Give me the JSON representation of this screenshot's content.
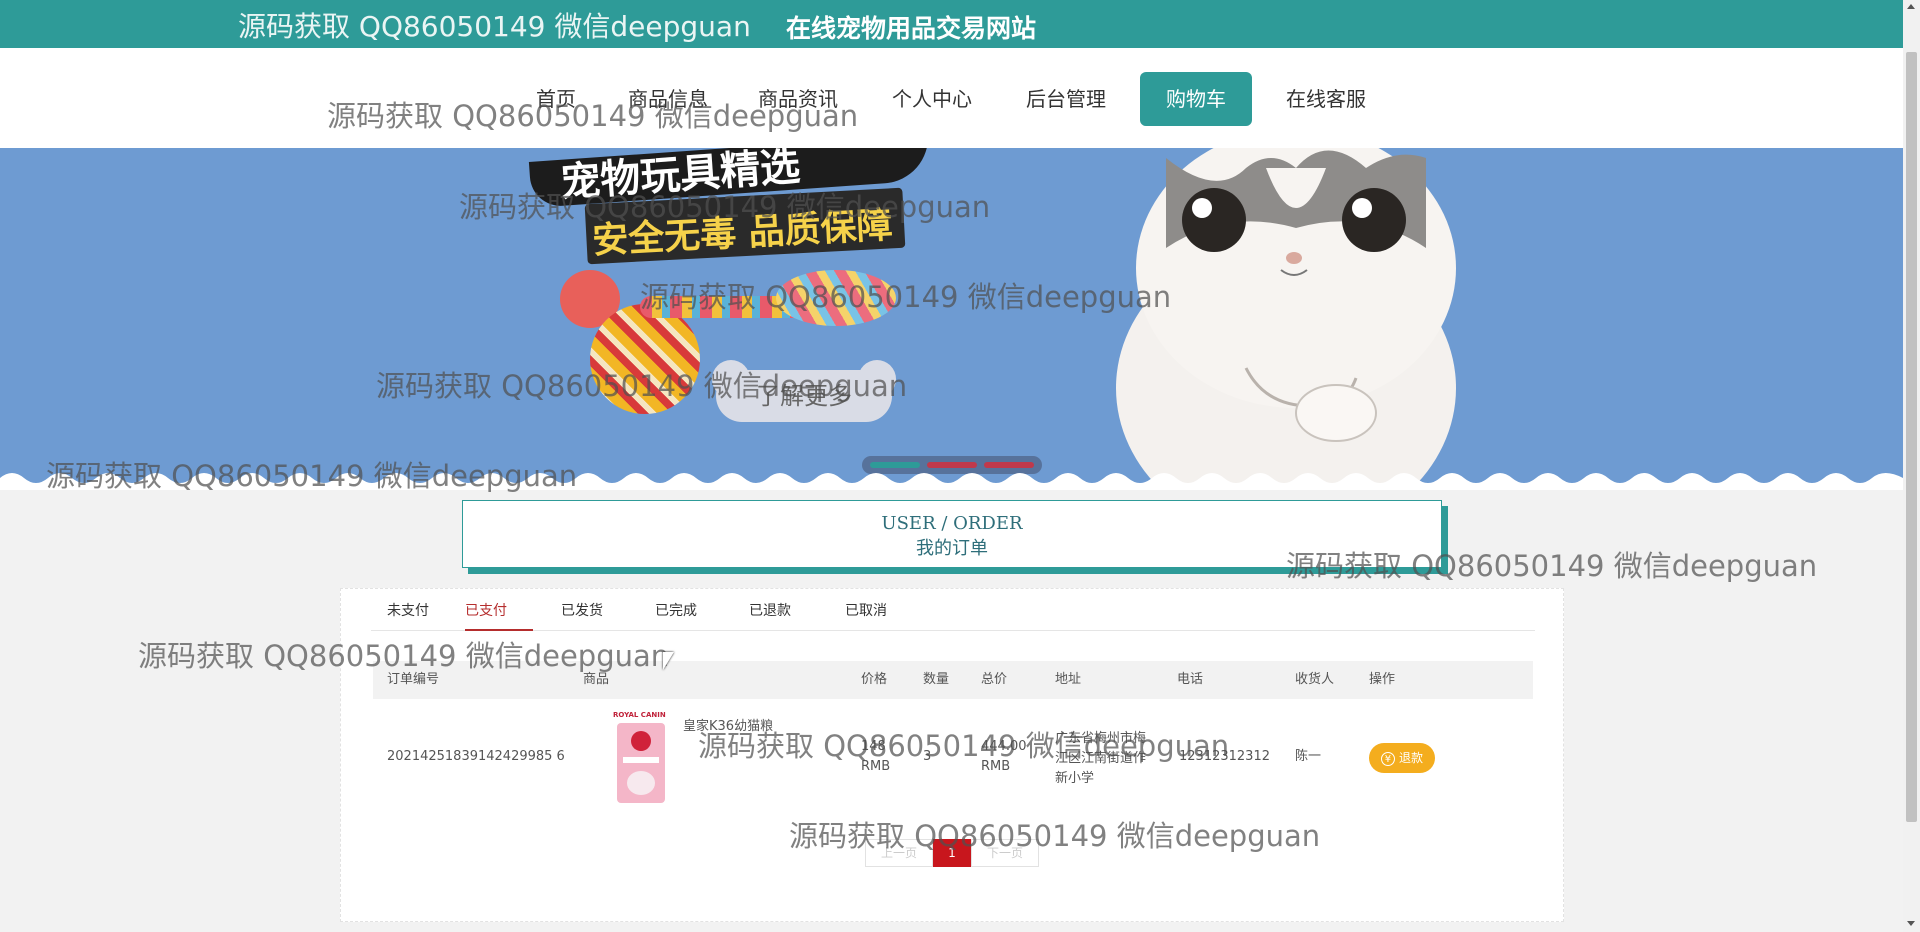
{
  "site": {
    "title": "在线宠物用品交易网站"
  },
  "nav": {
    "items": [
      {
        "label": "首页"
      },
      {
        "label": "商品信息"
      },
      {
        "label": "商品资讯"
      },
      {
        "label": "个人中心"
      },
      {
        "label": "后台管理"
      },
      {
        "label": "购物车",
        "active": true
      },
      {
        "label": "在线客服"
      }
    ]
  },
  "banner": {
    "title": "宠物玩具精选",
    "slogan": "安全无毒 品质保障",
    "learn_more": "了解更多",
    "active_slide": 1,
    "slide_count": 3
  },
  "order_header": {
    "en": "USER / ORDER",
    "cn": "我的订单"
  },
  "tabs": [
    {
      "label": "未支付"
    },
    {
      "label": "已支付",
      "active": true
    },
    {
      "label": "已发货"
    },
    {
      "label": "已完成"
    },
    {
      "label": "已退款"
    },
    {
      "label": "已取消"
    }
  ],
  "table": {
    "headers": [
      "订单编号",
      "商品",
      "价格",
      "数量",
      "总价",
      "地址",
      "电话",
      "收货人",
      "操作"
    ],
    "rows": [
      {
        "order_no": "20214251839142429985 6",
        "product_name": "皇家K36幼猫粮",
        "product_brand": "ROYAL CANIN",
        "price": "148",
        "price_unit": "RMB",
        "quantity": "3",
        "total": "444.00",
        "total_unit": "RMB",
        "address": "广东省梅州市梅江区江南街道作新小学",
        "phone": "12312312312",
        "receiver": "陈一",
        "action": "退款"
      }
    ]
  },
  "pager": {
    "prev": "上一页",
    "current": "1",
    "next": "下一页"
  },
  "watermark": {
    "text": "源码获取 QQ86050149 微信deepguan"
  },
  "colors": {
    "primary": "#2e9b98",
    "active_tab": "#b52d2d",
    "refund": "#f4ad1e",
    "pager_current": "#c8161d",
    "banner_bg": "#6e9bd2"
  }
}
